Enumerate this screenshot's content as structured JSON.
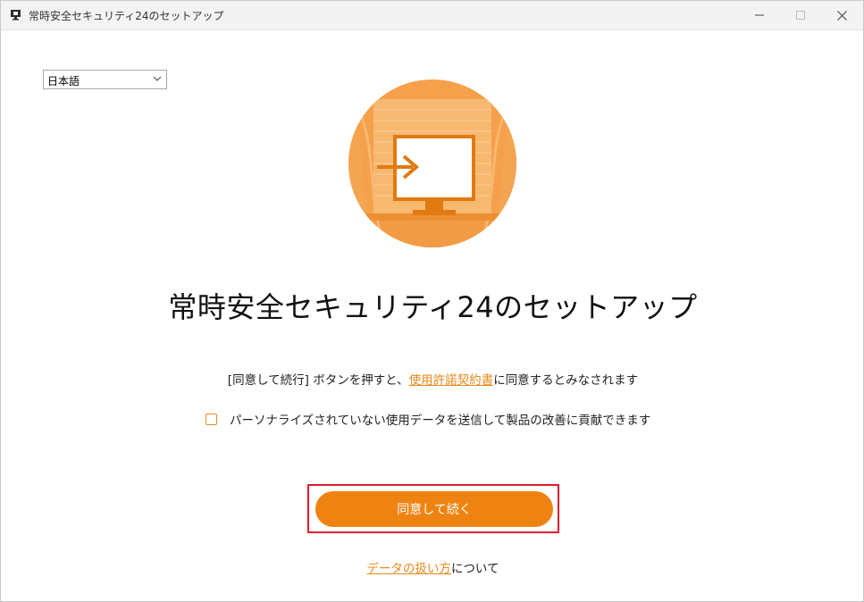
{
  "window": {
    "title": "常時安全セキュリティ24のセットアップ"
  },
  "language": {
    "selected": "日本語"
  },
  "main": {
    "title": "常時安全セキュリティ24のセットアップ",
    "agree_prefix": "[同意して続行] ボタンを押すと、",
    "agree_link": "使用許諾契約書",
    "agree_suffix": "に同意するとみなされます",
    "option_label": "パーソナライズされていない使用データを送信して製品の改善に貢献できます",
    "option_checked": false,
    "continue_label": "同意して続く",
    "data_link": "データの扱い方",
    "data_suffix": "について"
  },
  "colors": {
    "accent": "#ef8312",
    "link": "#e88a1c",
    "highlight": "#e01e2e"
  },
  "icons": {
    "app": "app-icon",
    "hero": "monitor-arrow-icon"
  }
}
